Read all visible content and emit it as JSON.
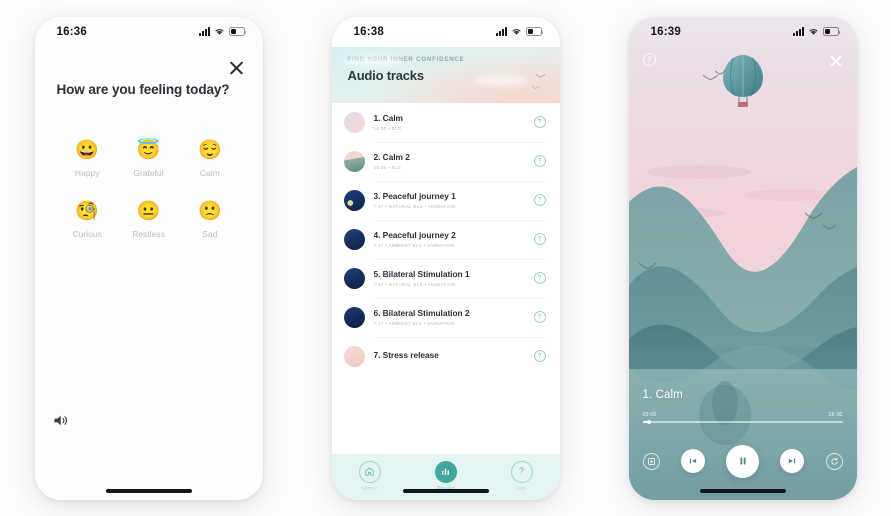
{
  "screens": {
    "mood": {
      "status": {
        "time": "16:36"
      },
      "close_icon": "close-icon",
      "title": "How are you feeling today?",
      "moods": [
        {
          "emoji": "😀",
          "label": "Happy"
        },
        {
          "emoji": "😇",
          "label": "Grateful"
        },
        {
          "emoji": "😌",
          "label": "Calm"
        },
        {
          "emoji": "🧐",
          "label": "Curious"
        },
        {
          "emoji": "😐",
          "label": "Restless"
        },
        {
          "emoji": "🙁",
          "label": "Sad"
        }
      ],
      "speaker_icon": "speaker-icon"
    },
    "playlist": {
      "status": {
        "time": "16:38"
      },
      "hero": {
        "kicker": "FIND YOUR INNER CONFIDENCE",
        "title": "Audio tracks"
      },
      "tracks": [
        {
          "name": "1. Calm",
          "sub": "16:30 • BLS"
        },
        {
          "name": "2. Calm 2",
          "sub": "20:49 • BLS"
        },
        {
          "name": "3. Peaceful journey 1",
          "sub": "7:37 • NATURAL BLS • ANIMATION"
        },
        {
          "name": "4. Peaceful journey 2",
          "sub": "7:37 • AMBIENT BLS • ANIMATION"
        },
        {
          "name": "5. Bilateral Stimulation 1",
          "sub": "7:37 • NATURAL BLS • ANIMATION"
        },
        {
          "name": "6. Bilateral Stimulation 2",
          "sub": "7:37 • AMBIENT BLS • ANIMATION"
        },
        {
          "name": "7. Stress release",
          "sub": ""
        }
      ],
      "row_help_icon": "help-icon",
      "tabs": [
        {
          "label": "Home",
          "icon": "home-icon",
          "active": false
        },
        {
          "label": "Playlist",
          "icon": "playlist-icon",
          "active": true
        },
        {
          "label": "Info",
          "icon": "info-icon",
          "active": false
        }
      ]
    },
    "player": {
      "status": {
        "time": "16:39"
      },
      "help_icon": "help-icon",
      "close_icon": "close-icon",
      "now_playing": "1. Calm",
      "elapsed": "00:05",
      "remaining": "16:30",
      "progress_percent": 3,
      "controls": [
        {
          "icon": "save-track-icon"
        },
        {
          "icon": "previous-icon"
        },
        {
          "icon": "pause-icon"
        },
        {
          "icon": "next-icon"
        },
        {
          "icon": "replay-icon"
        }
      ]
    }
  },
  "colors": {
    "teal": "#3fa79d",
    "tabbar_bg": "#e4f4f2",
    "sky_pink": "#f3d3dd",
    "hill_teal": "#6d9ba2",
    "text_dark": "#2b303b",
    "muted": "#b9bcc4"
  }
}
